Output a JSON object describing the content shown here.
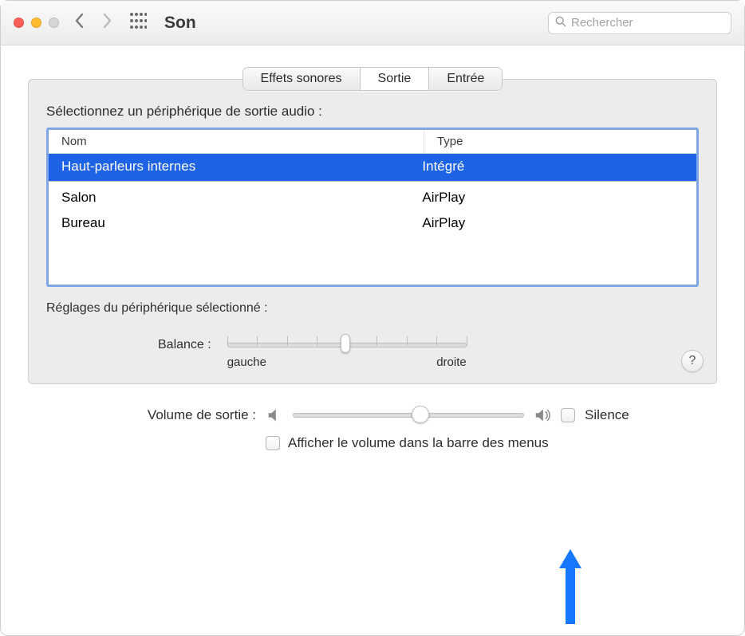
{
  "header": {
    "title": "Son",
    "search_placeholder": "Rechercher"
  },
  "tabs": {
    "soundeffects": "Effets sonores",
    "output": "Sortie",
    "input": "Entrée"
  },
  "section_label": "Sélectionnez un périphérique de sortie audio :",
  "columns": {
    "name": "Nom",
    "type": "Type"
  },
  "devices": [
    {
      "name": "Haut-parleurs internes",
      "type": "Intégré",
      "selected": true,
      "sep": true
    },
    {
      "name": "Salon",
      "type": "AirPlay"
    },
    {
      "name": "Bureau",
      "type": "AirPlay"
    }
  ],
  "settings_label": "Réglages du périphérique sélectionné :",
  "balance": {
    "label": "Balance :",
    "left": "gauche",
    "right": "droite"
  },
  "help": "?",
  "output_volume": {
    "label": "Volume de sortie :",
    "mute": "Silence"
  },
  "show_in_menubar": "Afficher le volume dans la barre des menus",
  "colors": {
    "selection": "#1e63e6",
    "focus_ring": "#7ea6e8",
    "arrow": "#1677ff"
  }
}
